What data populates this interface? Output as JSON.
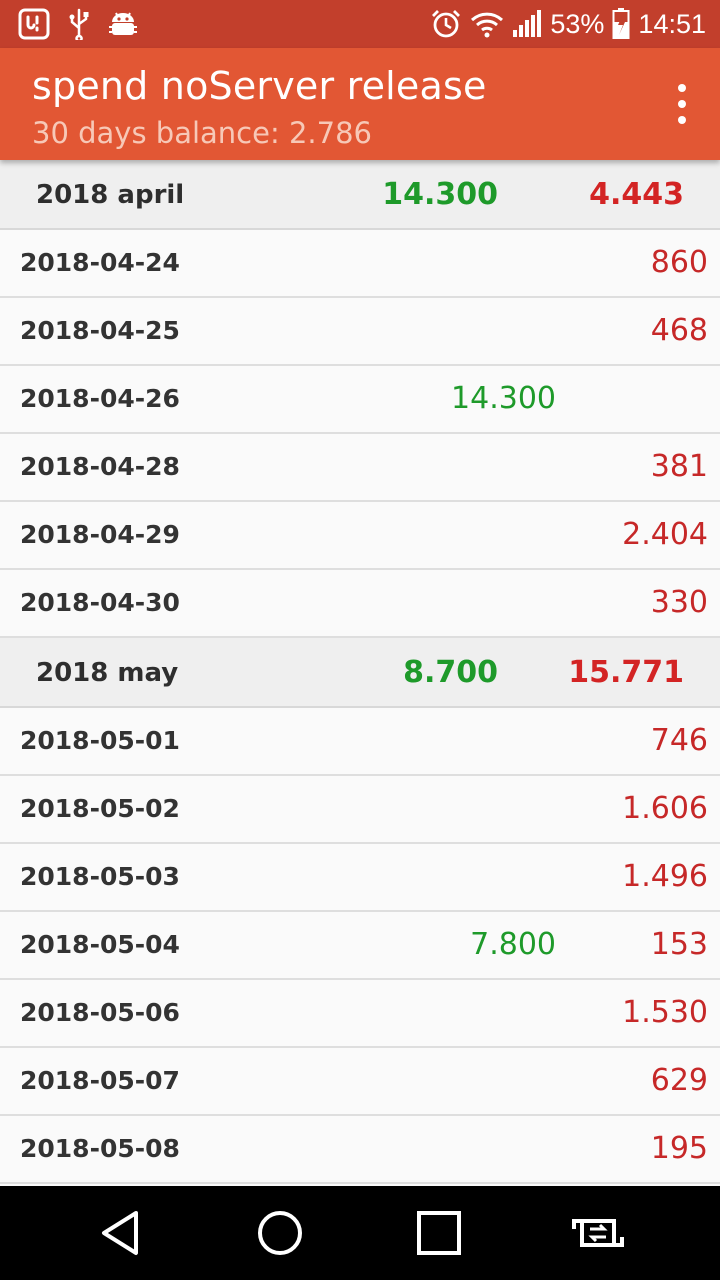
{
  "status_bar": {
    "battery_percent": "53%",
    "time": "14:51",
    "icons_left": [
      "app-notification-icon",
      "usb-icon",
      "android-debug-icon"
    ],
    "icons_right": [
      "alarm-icon",
      "wifi-icon",
      "signal-icon",
      "battery-charging-icon"
    ]
  },
  "app_bar": {
    "title": "spend noServer release",
    "subtitle": "30 days balance: 2.786",
    "menu_icon": "more-vert-icon"
  },
  "colors": {
    "status_bar": "#c23f2c",
    "app_bar": "#e25734",
    "income": "#1e9a2a",
    "expense": "#c62828",
    "month_bg": "#efefef"
  },
  "months": [
    {
      "label": "2018 april",
      "income": "14.300",
      "expense": "4.443",
      "days": [
        {
          "date": "2018-04-24",
          "income": "",
          "expense": "860"
        },
        {
          "date": "2018-04-25",
          "income": "",
          "expense": "468"
        },
        {
          "date": "2018-04-26",
          "income": "14.300",
          "expense": ""
        },
        {
          "date": "2018-04-28",
          "income": "",
          "expense": "381"
        },
        {
          "date": "2018-04-29",
          "income": "",
          "expense": "2.404"
        },
        {
          "date": "2018-04-30",
          "income": "",
          "expense": "330"
        }
      ]
    },
    {
      "label": "2018 may",
      "income": "8.700",
      "expense": "15.771",
      "days": [
        {
          "date": "2018-05-01",
          "income": "",
          "expense": "746"
        },
        {
          "date": "2018-05-02",
          "income": "",
          "expense": "1.606"
        },
        {
          "date": "2018-05-03",
          "income": "",
          "expense": "1.496"
        },
        {
          "date": "2018-05-04",
          "income": "7.800",
          "expense": "153"
        },
        {
          "date": "2018-05-06",
          "income": "",
          "expense": "1.530"
        },
        {
          "date": "2018-05-07",
          "income": "",
          "expense": "629"
        },
        {
          "date": "2018-05-08",
          "income": "",
          "expense": "195"
        }
      ]
    }
  ],
  "nav_bar": {
    "buttons": [
      "back-icon",
      "home-icon",
      "recents-icon",
      "screen-rotate-icon"
    ]
  }
}
